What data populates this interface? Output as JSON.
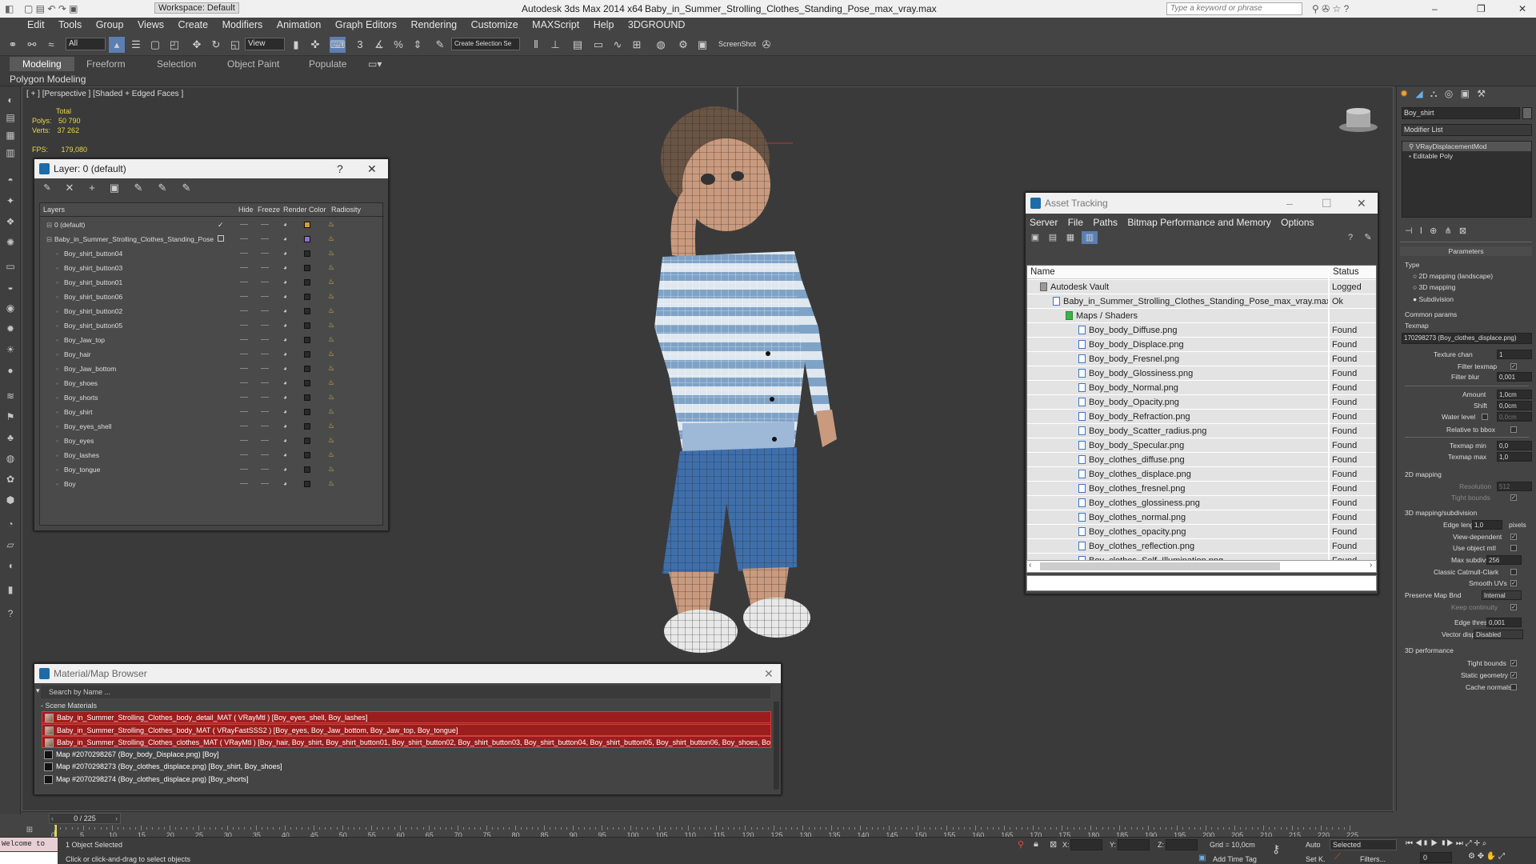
{
  "titlebar": {
    "workspace": "Workspace: Default",
    "app_title": "Autodesk 3ds Max  2014 x64",
    "file_name": "Baby_in_Summer_Strolling_Clothes_Standing_Pose_max_vray.max",
    "search_placeholder": "Type a keyword or phrase"
  },
  "menu": [
    "Edit",
    "Tools",
    "Group",
    "Views",
    "Create",
    "Modifiers",
    "Animation",
    "Graph Editors",
    "Rendering",
    "Customize",
    "MAXScript",
    "Help",
    "3DGROUND"
  ],
  "toolbar": {
    "filter": "All",
    "ref_coord": "View",
    "named_sel": "Create Selection Se",
    "screenshot": "ScreenShot"
  },
  "ribbon": {
    "tabs": [
      "Modeling",
      "Freeform",
      "Selection",
      "Object Paint",
      "Populate"
    ],
    "sub": "Polygon Modeling"
  },
  "viewport": {
    "label": "[ + ] [Perspective ] [Shaded + Edged Faces ]",
    "stats_total": "Total",
    "polys_label": "Polys:",
    "polys": "50 790",
    "verts_label": "Verts:",
    "verts": "37 262",
    "fps_label": "FPS:",
    "fps": "179,080"
  },
  "layer_dialog": {
    "title": "Layer: 0 (default)",
    "help": "?",
    "columns": [
      "Layers",
      "Hide",
      "Freeze",
      "Render",
      "Color",
      "Radiosity"
    ],
    "rows": [
      {
        "name": "0 (default)",
        "level": 0,
        "color": "#d8a020"
      },
      {
        "name": "Baby_in_Summer_Strolling_Clothes_Standing_Pose",
        "level": 0,
        "color": "#8e6fd0"
      },
      {
        "name": "Boy_shirt_button04",
        "level": 1
      },
      {
        "name": "Boy_shirt_button03",
        "level": 1
      },
      {
        "name": "Boy_shirt_button01",
        "level": 1
      },
      {
        "name": "Boy_shirt_button06",
        "level": 1
      },
      {
        "name": "Boy_shirt_button02",
        "level": 1
      },
      {
        "name": "Boy_shirt_button05",
        "level": 1
      },
      {
        "name": "Boy_Jaw_top",
        "level": 1
      },
      {
        "name": "Boy_hair",
        "level": 1
      },
      {
        "name": "Boy_Jaw_bottom",
        "level": 1
      },
      {
        "name": "Boy_shoes",
        "level": 1
      },
      {
        "name": "Boy_shorts",
        "level": 1
      },
      {
        "name": "Boy_shirt",
        "level": 1
      },
      {
        "name": "Boy_eyes_shell",
        "level": 1
      },
      {
        "name": "Boy_eyes",
        "level": 1
      },
      {
        "name": "Boy_lashes",
        "level": 1
      },
      {
        "name": "Boy_tongue",
        "level": 1
      },
      {
        "name": "Boy",
        "level": 1
      }
    ]
  },
  "asset_tracking": {
    "title": "Asset Tracking",
    "menu": [
      "Server",
      "File",
      "Paths",
      "Bitmap Performance and Memory",
      "Options"
    ],
    "col_name": "Name",
    "col_status": "Status",
    "rows": [
      {
        "name": "Autodesk Vault",
        "status": "Logged O...",
        "indent": 0
      },
      {
        "name": "Baby_in_Summer_Strolling_Clothes_Standing_Pose_max_vray.max",
        "status": "Ok",
        "indent": 1
      },
      {
        "name": "Maps / Shaders",
        "status": "",
        "indent": 2
      },
      {
        "name": "Boy_body_Diffuse.png",
        "status": "Found",
        "indent": 3
      },
      {
        "name": "Boy_body_Displace.png",
        "status": "Found",
        "indent": 3
      },
      {
        "name": "Boy_body_Fresnel.png",
        "status": "Found",
        "indent": 3
      },
      {
        "name": "Boy_body_Glossiness.png",
        "status": "Found",
        "indent": 3
      },
      {
        "name": "Boy_body_Normal.png",
        "status": "Found",
        "indent": 3
      },
      {
        "name": "Boy_body_Opacity.png",
        "status": "Found",
        "indent": 3
      },
      {
        "name": "Boy_body_Refraction.png",
        "status": "Found",
        "indent": 3
      },
      {
        "name": "Boy_body_Scatter_radius.png",
        "status": "Found",
        "indent": 3
      },
      {
        "name": "Boy_body_Specular.png",
        "status": "Found",
        "indent": 3
      },
      {
        "name": "Boy_clothes_diffuse.png",
        "status": "Found",
        "indent": 3
      },
      {
        "name": "Boy_clothes_displace.png",
        "status": "Found",
        "indent": 3
      },
      {
        "name": "Boy_clothes_fresnel.png",
        "status": "Found",
        "indent": 3
      },
      {
        "name": "Boy_clothes_glossiness.png",
        "status": "Found",
        "indent": 3
      },
      {
        "name": "Boy_clothes_normal.png",
        "status": "Found",
        "indent": 3
      },
      {
        "name": "Boy_clothes_opacity.png",
        "status": "Found",
        "indent": 3
      },
      {
        "name": "Boy_clothes_reflection.png",
        "status": "Found",
        "indent": 3
      },
      {
        "name": "Boy_clothes_Self_Illumination.png",
        "status": "Found",
        "indent": 3
      }
    ]
  },
  "material_browser": {
    "title": "Material/Map Browser",
    "search_placeholder": "Search by Name ...",
    "section": "- Scene Materials",
    "rows": [
      {
        "text": "Baby_in_Summer_Strolling_Clothes_body_detail_MAT ( VRayMtl ) [Boy_eyes_shell, Boy_lashes]",
        "highlight": true
      },
      {
        "text": "Baby_in_Summer_Strolling_Clothes_body_MAT ( VRayFastSSS2 ) [Boy_eyes, Boy_Jaw_bottom, Boy_Jaw_top, Boy_tongue]",
        "highlight": true
      },
      {
        "text": "Baby_in_Summer_Strolling_Clothes_clothes_MAT ( VRayMtl ) [Boy_hair, Boy_shirt, Boy_shirt_button01, Boy_shirt_button02, Boy_shirt_button03, Boy_shirt_button04, Boy_shirt_button05, Boy_shirt_button06, Boy_shoes, Boy_shorts]",
        "highlight": true
      },
      {
        "text": "Map #2070298267 (Boy_body_Displace.png) [Boy]",
        "highlight": false
      },
      {
        "text": "Map #2070298273 (Boy_clothes_displace.png) [Boy_shirt, Boy_shoes]",
        "highlight": false
      },
      {
        "text": "Map #2070298274 (Boy_clothes_displace.png) [Boy_shorts]",
        "highlight": false
      }
    ]
  },
  "command_panel": {
    "object_name": "Boy_shirt",
    "modifier_list": "Modifier List",
    "stack": [
      "VRayDisplacementMod",
      "Editable Poly"
    ],
    "parameters": "Parameters",
    "type_label": "Type",
    "type_opts": [
      "2D mapping (landscape)",
      "3D mapping",
      "Subdivision"
    ],
    "common_params": "Common params",
    "texmap_label": "Texmap",
    "texmap": "170298273 (Boy_clothes_displace.png)",
    "texture_chan_label": "Texture chan",
    "texture_chan": "1",
    "filter_texmap": "Filter texmap",
    "filter_blur_label": "Filter blur",
    "filter_blur": "0,001",
    "amount_label": "Amount",
    "amount": "1,0cm",
    "shift_label": "Shift",
    "shift": "0,0cm",
    "water_level_label": "Water level",
    "water_level": "0,0cm",
    "relative_bbox": "Relative to bbox",
    "texmap_min_label": "Texmap min",
    "texmap_min": "0,0",
    "texmap_max_label": "Texmap max",
    "texmap_max": "1,0",
    "mapping2d": "2D mapping",
    "resolution_label": "Resolution",
    "resolution": "512",
    "tight_bounds": "Tight bounds",
    "mapping3d": "3D mapping/subdivision",
    "edge_length_label": "Edge length",
    "edge_length": "1,0",
    "pixels": "pixels",
    "view_dependent": "View-dependent",
    "use_object_mtl": "Use object mtl",
    "max_subdivs_label": "Max subdivs",
    "max_subdivs": "256",
    "classic_cc": "Classic Catmull-Clark",
    "smooth_uvs": "Smooth UVs",
    "preserve_map_label": "Preserve Map Bnd",
    "preserve_map": "Internal",
    "keep_continuity": "Keep continuity",
    "edge_thresh_label": "Edge thresh",
    "edge_thresh": "0,001",
    "vector_displ_label": "Vector displ",
    "vector_displ": "Disabled",
    "perf": "3D performance",
    "tight_bounds2": "Tight bounds",
    "static_geo": "Static geometry",
    "cache_normals": "Cache normals"
  },
  "timeline": {
    "frame": "0 / 225",
    "ticks": [
      "0",
      "5",
      "10",
      "15",
      "20",
      "25",
      "30",
      "35",
      "40",
      "45",
      "50",
      "55",
      "60",
      "65",
      "70",
      "75",
      "80",
      "85",
      "90",
      "95",
      "100",
      "105",
      "110",
      "115",
      "120",
      "125",
      "130",
      "135",
      "140",
      "145",
      "150",
      "155",
      "160",
      "165",
      "170",
      "175",
      "180",
      "185",
      "190",
      "195",
      "200",
      "205",
      "210",
      "215",
      "220",
      "225"
    ]
  },
  "status": {
    "listener": "Welcome to",
    "selected": "1 Object Selected",
    "prompt": "Click or click-and-drag to select objects",
    "x_label": "X:",
    "y_label": "Y:",
    "z_label": "Z:",
    "grid": "Grid = 10,0cm",
    "add_time_tag": "Add Time Tag",
    "auto": "Auto",
    "set_key": "Set K.",
    "selected_dd": "Selected",
    "filters": "Filters...",
    "frame_field": "0"
  }
}
